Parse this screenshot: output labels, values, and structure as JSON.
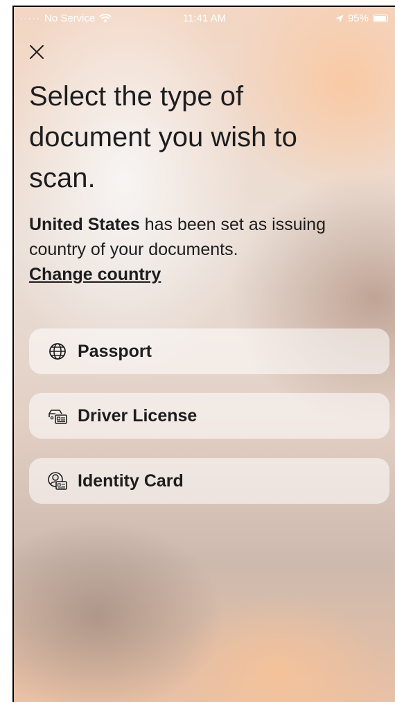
{
  "status_bar": {
    "carrier": "No Service",
    "time": "11:41 AM",
    "battery": "95%",
    "icons": [
      "wifi-icon",
      "location-arrow-icon",
      "battery-icon"
    ]
  },
  "screen": {
    "close_icon": "close-icon",
    "title": "Select the type of document you wish to scan.",
    "country_name": "United States",
    "country_suffix": " has been set as issuing country of your documents.",
    "change_country": "Change country"
  },
  "options": [
    {
      "label": "Passport",
      "icon": "globe-icon"
    },
    {
      "label": "Driver License",
      "icon": "car-id-card-icon"
    },
    {
      "label": "Identity Card",
      "icon": "person-id-card-icon"
    }
  ],
  "colors": {
    "text": "#1d1d1f",
    "status_text": "#ffffff",
    "card_bg": "rgba(255,255,255,0.55)"
  }
}
